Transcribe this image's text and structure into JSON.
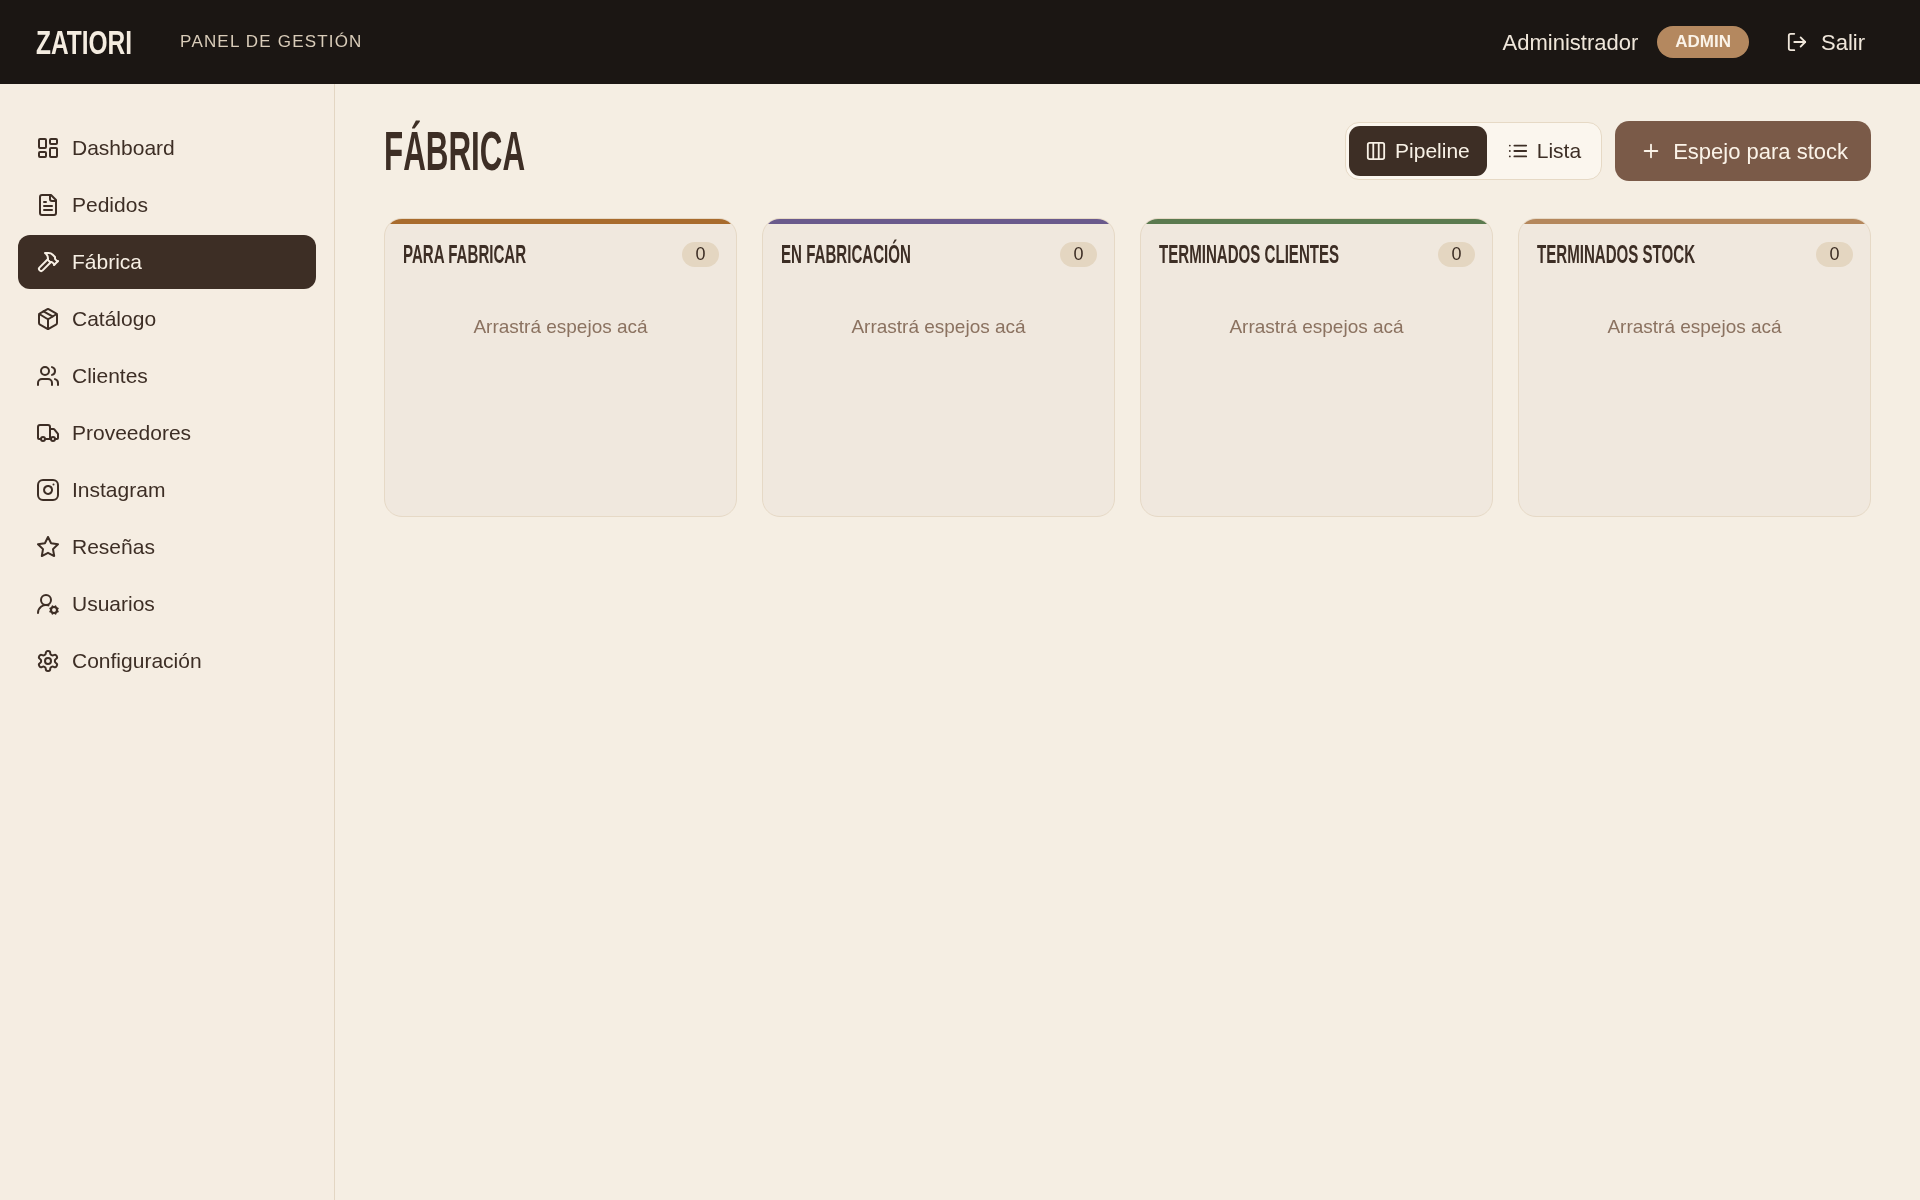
{
  "header": {
    "logo": "ZATIORI",
    "subtitle": "PANEL DE GESTIÓN",
    "user_name": "Administrador",
    "role_badge": "ADMIN",
    "logout": "Salir"
  },
  "sidebar": {
    "items": [
      {
        "label": "Dashboard",
        "selected": false
      },
      {
        "label": "Pedidos",
        "selected": false
      },
      {
        "label": "Fábrica",
        "selected": true
      },
      {
        "label": "Catálogo",
        "selected": false
      },
      {
        "label": "Clientes",
        "selected": false
      },
      {
        "label": "Proveedores",
        "selected": false
      },
      {
        "label": "Instagram",
        "selected": false
      },
      {
        "label": "Reseñas",
        "selected": false
      },
      {
        "label": "Usuarios",
        "selected": false
      },
      {
        "label": "Configuración",
        "selected": false
      }
    ]
  },
  "page": {
    "title": "FÁBRICA",
    "view_toggle": [
      {
        "label": "Pipeline",
        "selected": true
      },
      {
        "label": "Lista",
        "selected": false
      }
    ],
    "primary_button": "Espejo para stock"
  },
  "columns": [
    {
      "title": "PARA FABRICAR",
      "count": "0",
      "empty_text": "Arrastrá espejos acá",
      "color": "#a86b2d"
    },
    {
      "title": "EN FABRICACIÓN",
      "count": "0",
      "empty_text": "Arrastrá espejos acá",
      "color": "#6a5a8c"
    },
    {
      "title": "TERMINADOS CLIENTES",
      "count": "0",
      "empty_text": "Arrastrá espejos acá",
      "color": "#5b7a4f"
    },
    {
      "title": "TERMINADOS STOCK",
      "count": "0",
      "empty_text": "Arrastrá espejos acá",
      "color": "#b4875c"
    }
  ]
}
